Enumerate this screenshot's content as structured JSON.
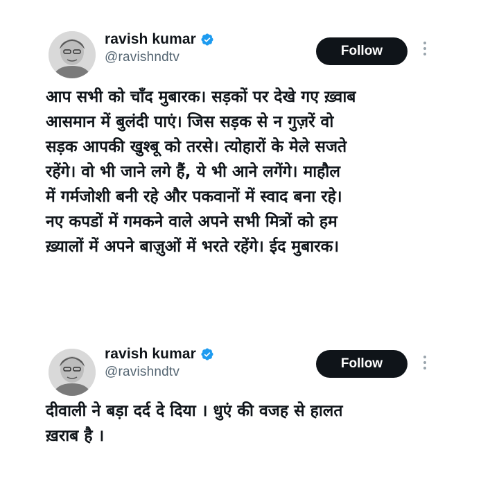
{
  "tweets": [
    {
      "author": {
        "display_name": "ravish kumar",
        "handle": "@ravishndtv",
        "verified_icon": "verified-badge-icon",
        "verified_color": "#1d9bf0"
      },
      "follow_label": "Follow",
      "more_icon": "more-options-icon",
      "text": "आप सभी को चाँद मुबारक। सड़कों पर देखे गए ख़्वाब\nआसमान में बुलंदी पाएं। जिस सड़क से न गुज़रें वो\nसड़क आपकी खुश्बू को तरसे। त्योहारों के मेले सजते\nरहेंगे। वो भी जाने लगे हैं, ये भी आने लगेंगे। माहौल\nमें गर्मजोशी बनी रहे और पकवानों में स्वाद बना रहे।\nनए कपडों में गमकने वाले अपने सभी मित्रों को हम\nख़्यालों में अपने बाज़ुओं में भरते रहेंगे। ईद मुबारक।"
    },
    {
      "author": {
        "display_name": "ravish kumar",
        "handle": "@ravishndtv",
        "verified_icon": "verified-badge-icon",
        "verified_color": "#1d9bf0"
      },
      "follow_label": "Follow",
      "more_icon": "more-options-icon",
      "text": "दीवाली ने बड़ा दर्द दे दिया । धुएं की वजह से हालत\nख़राब है ।"
    }
  ]
}
